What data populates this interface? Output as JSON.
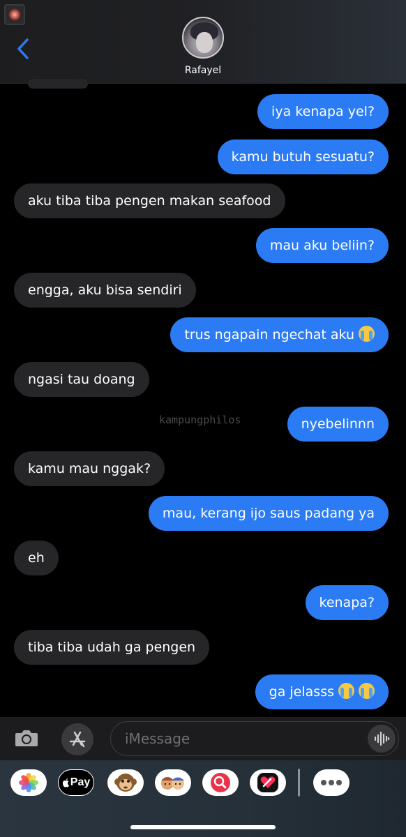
{
  "header": {
    "contact_name": "Rafayel",
    "back_icon": "chevron-left-icon"
  },
  "watermark": "kampungphilos",
  "messages": [
    {
      "side": "sent",
      "text": "iya kenapa yel?",
      "emoji_count": 0
    },
    {
      "side": "sent",
      "text": "kamu butuh sesuatu?",
      "emoji_count": 0
    },
    {
      "side": "received",
      "text": "aku tiba tiba pengen makan seafood",
      "emoji_count": 0
    },
    {
      "side": "sent",
      "text": "mau aku beliin?",
      "emoji_count": 0
    },
    {
      "side": "received",
      "text": "engga, aku bisa sendiri",
      "emoji_count": 0
    },
    {
      "side": "sent",
      "text": "trus ngapain ngechat aku",
      "emoji_count": 1
    },
    {
      "side": "received",
      "text": "ngasi tau doang",
      "emoji_count": 0
    },
    {
      "side": "sent",
      "text": "nyebelinnn",
      "emoji_count": 0
    },
    {
      "side": "received",
      "text": "kamu mau nggak?",
      "emoji_count": 0
    },
    {
      "side": "sent",
      "text": "mau, kerang ijo saus padang ya",
      "emoji_count": 0
    },
    {
      "side": "received",
      "text": "eh",
      "emoji_count": 0
    },
    {
      "side": "sent",
      "text": "kenapa?",
      "emoji_count": 0
    },
    {
      "side": "received",
      "text": "tiba tiba udah ga pengen",
      "emoji_count": 0
    },
    {
      "side": "sent",
      "text": "ga jelasss",
      "emoji_count": 2
    }
  ],
  "input": {
    "placeholder": "iMessage",
    "value": ""
  },
  "app_drawer": {
    "apple_pay_label": "Pay",
    "apps": [
      "photos-icon",
      "apple-pay-icon",
      "monkey-memoji-icon",
      "memoji-icon",
      "image-search-icon",
      "digital-touch-icon",
      "more-icon"
    ]
  },
  "colors": {
    "sent_bubble": "#2b7bf5",
    "received_bubble": "#262628",
    "background": "#000000"
  }
}
